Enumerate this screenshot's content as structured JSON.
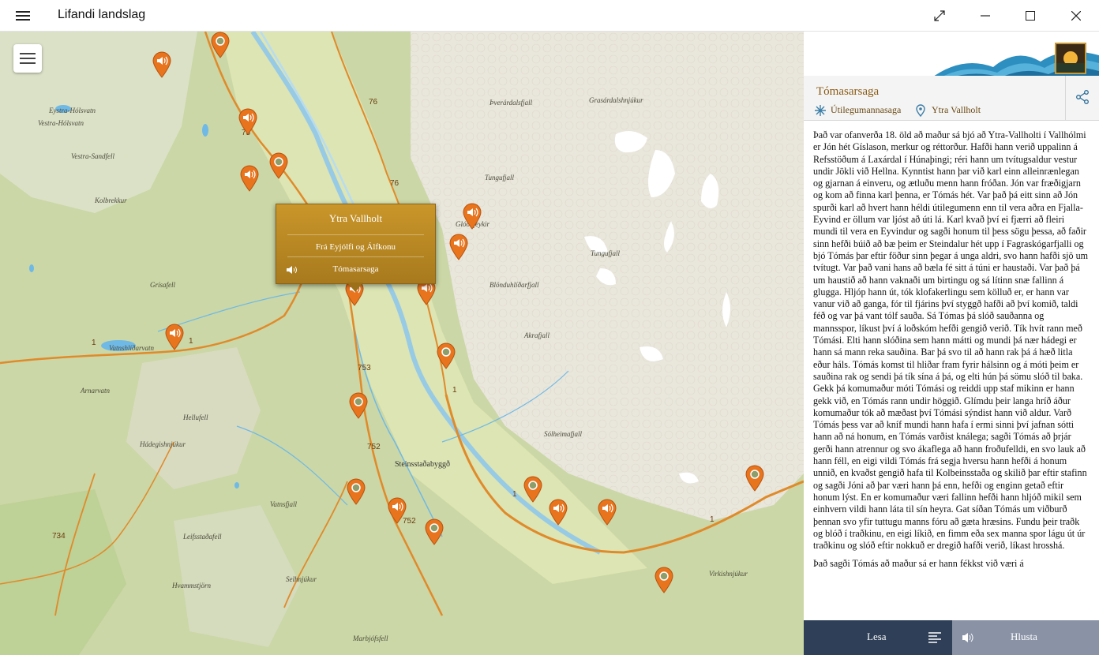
{
  "window": {
    "title": "Lifandi landslag"
  },
  "map": {
    "places": [
      "Eystra-Hólsvatn",
      "Vestra-Hólsvatn",
      "Vestra-Sandfell",
      "Kolbrekkur",
      "Grísafell",
      "Vatnshlíðarvatn",
      "Arnarvatn",
      "Hellufell",
      "Hádegishnjúkur",
      "Vatnsfjall",
      "Leifsstaðafell",
      "Hvammstjörn",
      "Selhnjúkur",
      "Marbjófsfell",
      "Steinsstaðabyggð",
      "Þverárdalsfjall",
      "Grasárdalshnjúkur",
      "Tungufjall",
      "Glóðafeykir",
      "Tungufjall",
      "Blönduhlíðarfjall",
      "Akrafjall",
      "Sólheimafjall",
      "Virkishnjúkur"
    ],
    "roads": [
      "76",
      "75",
      "76",
      "1",
      "1",
      "753",
      "752",
      "752",
      "734",
      "1",
      "1",
      "1"
    ]
  },
  "popup": {
    "title": "Ytra Vallholt",
    "items": [
      "Frá Eyjólfi og Álfkonu",
      "Tómasarsaga"
    ]
  },
  "panel": {
    "title": "Tómasarsaga",
    "category": "Útilegumannasaga",
    "location": "Ytra Vallholt",
    "paragraphs": [
      "Það var ofanverða 18. öld að maður sá bjó að Ytra-Vallholti í Vallhólmi er Jón hét Gíslason, merkur og réttorður. Hafði hann verið uppalinn á Refsstöðum á Laxárdal í Húnaþingi; réri hann um tvítugsaldur vestur undir Jökli við Hellna. Kynntist hann þar við karl einn alleinrænlegan og gjarnan á einveru, og ætluðu menn hann fróðan. Jón var fræðigjarn og kom að finna karl þenna, er Tómás hét. Var það þá eitt sinn að Jón spurði karl að hvert hann héldi útilegumenn enn til vera aðra en Fjalla-Eyvind er öllum var ljóst að úti lá. Karl kvað því ei fjærri að fleiri mundi til vera en Eyvindur og sagði honum til þess sögu þessa, að faðir sinn hefði búið að bæ þeim er Steindalur hét upp í Fagraskógarfjalli og bjó Tómás þar eftir föður sinn þegar á unga aldri, svo hann hafði sjö um tvítugt. Var það vani hans að bæla fé sitt á túni er haustaði. Var það þá um haustið að hann vaknaði um birtingu og sá lítinn snæ fallinn á glugga. Hljóp hann út, tók klofakerlingu sem kölluð er, er hann var vanur við að ganga, fór til fjárins því styggð hafði að því komið, taldi féð og var þá vant tólf sauða. Sá Tómas þá slóð sauðanna og mannsspor, líkust því á loðskóm hefði gengið verið. Tík hvít rann með Tómási. Elti hann slóðina sem hann mátti og mundi þá nær hádegi er hann sá mann reka sauðina. Bar þá svo til að hann rak þá á hæð litla eður háls. Tómás komst til hliðar fram fyrir hálsinn og á móti þeim er sauðina rak og sendi þá tík sína á þá, og elti hún þá sömu slóð til baka. Gekk þá komumaður móti Tómási og reiddi upp staf mikinn er hann gekk við, en Tómás rann undir höggið. Glímdu þeir langa hríð áður komumaður tók að mæðast því Tómási sýndist hann við aldur. Varð Tómás þess var að kníf mundi hann hafa í ermi sinni því jafnan sótti hann að ná honum, en Tómás varðist knálega; sagði Tómás að þrjár gerði hann atrennur og svo ákaflega að hann froðufelldi, en svo lauk að hann féll, en eigi vildi Tómás frá segja hversu hann hefði á honum unnið, en kvaðst gengið hafa til Kolbeinsstaða og skilið þar eftir stafinn og sagði Jóni að þar væri hann þá enn, hefði og enginn getað eftir honum lýst. En er komumaður væri fallinn hefði hann hljóð mikil sem einhvern vildi hann láta til sín heyra. Gat síðan Tómás um viðburð þennan svo yfir tuttugu manns fóru að gæta hræsins. Fundu þeir traðk og blóð í traðkinu, en eigi líkið, en fimm eða sex manna spor lágu út úr traðkinu og slóð eftir nokkuð er dregið hafði verið, líkast hrosshá.",
      "Það sagði Tómás að maður sá er hann fékkst við væri á"
    ]
  },
  "bottom": {
    "read_label": "Lesa",
    "listen_label": "Hlusta"
  },
  "colors": {
    "accent_orange": "#e8741e",
    "popup_gold": "#b8872a",
    "panel_dark": "#2e3f57"
  }
}
